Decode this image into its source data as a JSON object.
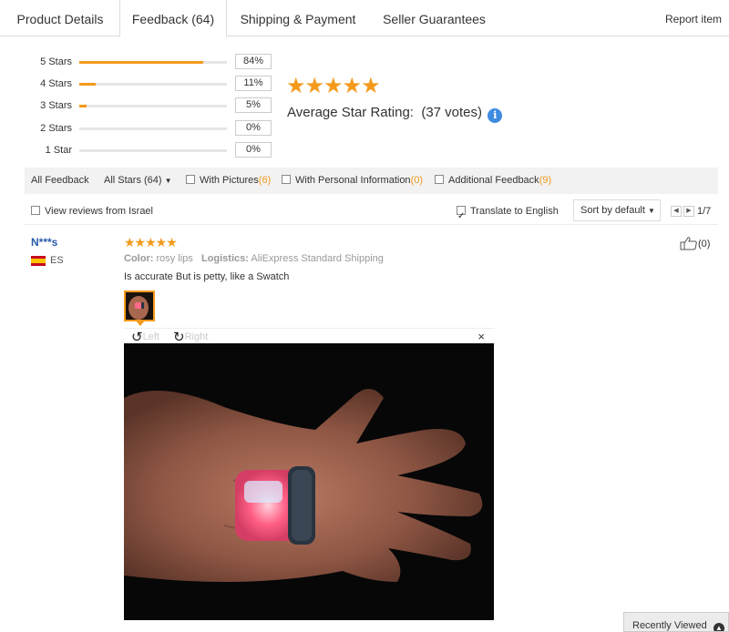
{
  "tabs": [
    {
      "label": "Product Details"
    },
    {
      "label": "Feedback (64)"
    },
    {
      "label": "Shipping & Payment"
    },
    {
      "label": "Seller Guarantees"
    }
  ],
  "report_label": "Report item",
  "histogram": [
    {
      "label": "5 Stars",
      "pct": "84%",
      "fill": 0.84
    },
    {
      "label": "4 Stars",
      "pct": "11%",
      "fill": 0.11
    },
    {
      "label": "3 Stars",
      "pct": "5%",
      "fill": 0.05
    },
    {
      "label": "2 Stars",
      "pct": "0%",
      "fill": 0
    },
    {
      "label": "1 Star",
      "pct": "0%",
      "fill": 0
    }
  ],
  "summary": {
    "stars": "★★★★★",
    "label": "Average Star Rating:",
    "votes": "(37 votes)",
    "info": "i"
  },
  "filters": {
    "all_feedback": "All Feedback",
    "all_stars": "All Stars (64)",
    "with_pictures": "With Pictures",
    "with_pictures_count": "(6)",
    "with_personal": "With Personal Information",
    "with_personal_count": "(0)",
    "additional": "Additional Feedback",
    "additional_count": "(9)",
    "view_israel": "View reviews from Israel",
    "translate": "Translate to English",
    "sort": "Sort by default",
    "page": "1/7"
  },
  "review": {
    "reviewer": "N***s",
    "country": "ES",
    "stars": "★★★★★",
    "color_label": "Color:",
    "color_value": "rosy lips",
    "logistics_label": "Logistics:",
    "logistics_value": "AliExpress Standard Shipping",
    "text": "Is accurate But is petty, like a Swatch",
    "like_count": "(0)"
  },
  "viewer": {
    "left": "Left",
    "right": "Right",
    "close": "×"
  },
  "recently_viewed": "Recently Viewed",
  "colors": {
    "accent": "#f39a1b",
    "link": "#2a5ca8",
    "info": "#3d8ce0"
  }
}
